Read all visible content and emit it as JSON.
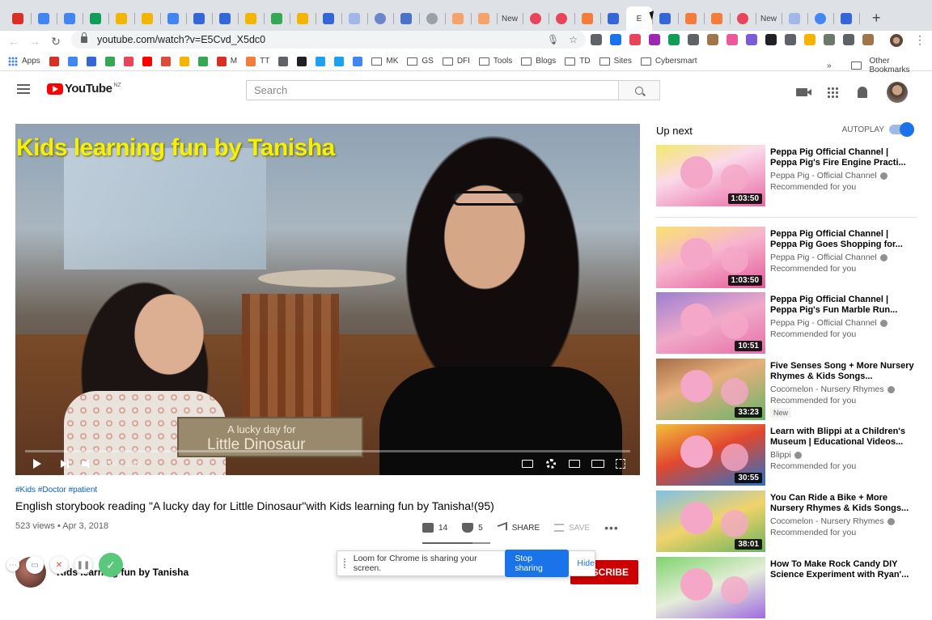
{
  "browser": {
    "tabs": [
      {
        "icon": "gmail-icon",
        "color": "#d93025",
        "text": ""
      },
      {
        "icon": "calendar-icon",
        "color": "#4285f4",
        "text": ""
      },
      {
        "icon": "docs-icon",
        "color": "#4285f4",
        "text": ""
      },
      {
        "icon": "sheets-icon",
        "color": "#0f9d58",
        "text": ""
      },
      {
        "icon": "hand-icon",
        "color": "#f4b400",
        "text": ""
      },
      {
        "icon": "slides-icon",
        "color": "#f4b400",
        "text": ""
      },
      {
        "icon": "docs-icon",
        "color": "#4285f4",
        "text": ""
      },
      {
        "icon": "forms-icon",
        "color": "#3367d6",
        "text": ""
      },
      {
        "icon": "forms-icon",
        "color": "#3367d6",
        "text": ""
      },
      {
        "icon": "slides-icon",
        "color": "#f4b400",
        "text": ""
      },
      {
        "icon": "drive-icon",
        "color": "#34a853",
        "text": ""
      },
      {
        "icon": "slides-icon",
        "color": "#f4b400",
        "text": ""
      },
      {
        "icon": "forms-icon",
        "color": "#3367d6",
        "text": ""
      },
      {
        "icon": "docs-icon",
        "color": "#a0b8e8",
        "text": ""
      },
      {
        "icon": "globe-icon",
        "color": "#6a87c8",
        "text": ""
      },
      {
        "icon": "site-icon",
        "color": "#4a72c8",
        "text": ""
      },
      {
        "icon": "globe-icon",
        "color": "#9aa0a6",
        "text": ""
      },
      {
        "icon": "blogger-icon",
        "color": "#f5a36b",
        "text": ""
      },
      {
        "icon": "blogger-icon",
        "color": "#f5a36b",
        "text": ""
      },
      {
        "icon": "new-tab",
        "color": "",
        "text": "New"
      },
      {
        "icon": "t-icon",
        "color": "#e8455b",
        "text": ""
      },
      {
        "icon": "t-icon",
        "color": "#e8455b",
        "text": ""
      },
      {
        "icon": "blogger-icon",
        "color": "#f57d3b",
        "text": ""
      },
      {
        "icon": "forms-icon",
        "color": "#3367d6",
        "text": ""
      },
      {
        "icon": "active-tab",
        "color": "",
        "text": "E"
      },
      {
        "icon": "forms-icon",
        "color": "#3367d6",
        "text": ""
      },
      {
        "icon": "blogger-icon",
        "color": "#f57d3b",
        "text": ""
      },
      {
        "icon": "blogger-icon",
        "color": "#f57d3b",
        "text": ""
      },
      {
        "icon": "spiral-icon",
        "color": "#e8455b",
        "text": ""
      },
      {
        "icon": "new-tab",
        "color": "",
        "text": "New"
      },
      {
        "icon": "docs-icon",
        "color": "#a0b8e8",
        "text": ""
      },
      {
        "icon": "google-icon",
        "color": "#4285f4",
        "text": ""
      },
      {
        "icon": "forms-icon",
        "color": "#3367d6",
        "text": ""
      }
    ],
    "new_tab_symbol": "+",
    "url": "youtube.com/watch?v=E5Cvd_X5dc0",
    "extension_colors": [
      "#5f6368",
      "#1a73e8",
      "#e8455b",
      "#9c27b0",
      "#0f9d58",
      "#5f6368",
      "#a0754a",
      "#e85a9a",
      "#7b5cd6",
      "#202124",
      "#5f6368",
      "#f4b400",
      "#6d7a6a",
      "#5f6368",
      "#a0754a"
    ],
    "bookmarks": [
      {
        "label": "Apps",
        "icon": "apps-grid-icon",
        "color": "#4285f4"
      },
      {
        "label": "",
        "icon": "gmail-icon",
        "color": "#d93025"
      },
      {
        "label": "",
        "icon": "calendar-icon",
        "color": "#4285f4"
      },
      {
        "label": "",
        "icon": "chat-icon",
        "color": "#3367d6"
      },
      {
        "label": "",
        "icon": "drive-icon",
        "color": "#34a853"
      },
      {
        "label": "",
        "icon": "t-icon",
        "color": "#e8455b"
      },
      {
        "label": "",
        "icon": "youtube-icon",
        "color": "#ff0000"
      },
      {
        "label": "",
        "icon": "google-plus-icon",
        "color": "#dd4b39"
      },
      {
        "label": "",
        "icon": "photos-icon",
        "color": "#f4b400"
      },
      {
        "label": "",
        "icon": "maps-icon",
        "color": "#34a853"
      },
      {
        "label": "M",
        "icon": "m-icon",
        "color": "#d93025"
      },
      {
        "label": "TT",
        "icon": "blogger-icon",
        "color": "#f57d3b"
      },
      {
        "label": "",
        "icon": "globe-icon",
        "color": "#5f6368"
      },
      {
        "label": "",
        "icon": "book-icon",
        "color": "#202124"
      },
      {
        "label": "",
        "icon": "twitter-icon",
        "color": "#1da1f2"
      },
      {
        "label": "",
        "icon": "twitter-icon",
        "color": "#1da1f2"
      },
      {
        "label": "",
        "icon": "google-icon",
        "color": "#4285f4"
      },
      {
        "label": "MK",
        "icon": "folder-icon",
        "color": ""
      },
      {
        "label": "GS",
        "icon": "folder-icon",
        "color": ""
      },
      {
        "label": "DFI",
        "icon": "folder-icon",
        "color": ""
      },
      {
        "label": "Tools",
        "icon": "folder-icon",
        "color": ""
      },
      {
        "label": "Blogs",
        "icon": "folder-icon",
        "color": ""
      },
      {
        "label": "TD",
        "icon": "folder-icon",
        "color": ""
      },
      {
        "label": "Sites",
        "icon": "folder-icon",
        "color": ""
      },
      {
        "label": "Cybersmart",
        "icon": "folder-icon",
        "color": ""
      }
    ],
    "bookmarks_overflow": "»",
    "other_bookmarks": "Other Bookmarks"
  },
  "youtube": {
    "logo_text": "YouTube",
    "logo_country": "NZ",
    "search_placeholder": "Search",
    "video": {
      "overlay_title": "Kids learning fun by Tanisha",
      "subtitle_line1": "A lucky day for",
      "subtitle_line2": "Little Dinosaur",
      "time": "0:00 / 3:49",
      "progress": 0,
      "hashtags": "#Kids #Doctor #patient",
      "title": "English storybook reading \"A lucky day for Little Dinosaur\"with Kids learning fun by Tanisha!(95)",
      "views_date": "523 views • Apr 3, 2018",
      "likes": "14",
      "dislikes": "5",
      "share_label": "SHARE",
      "save_label": "SAVE",
      "like_ratio": 0.74
    },
    "channel": {
      "name": "Kids learning fun by Tanisha",
      "subscribe_label": "SUBSCRIBE"
    },
    "up_next_label": "Up next",
    "autoplay_label": "AUTOPLAY",
    "recommendations": [
      {
        "title": "Peppa Pig Official Channel | Peppa Pig's Fire Engine Practi...",
        "channel": "Peppa Pig - Official Channel",
        "verified": true,
        "reason": "Recommended for you",
        "duration": "1:03:50",
        "new": "",
        "thumb": "peppa"
      },
      {
        "title": "Peppa Pig Official Channel | Peppa Pig Goes Shopping for...",
        "channel": "Peppa Pig - Official Channel",
        "verified": true,
        "reason": "Recommended for you",
        "duration": "1:03:50",
        "new": "",
        "thumb": "peppa2"
      },
      {
        "title": "Peppa Pig Official Channel | Peppa Pig's Fun Marble Run...",
        "channel": "Peppa Pig - Official Channel",
        "verified": true,
        "reason": "Recommended for you",
        "duration": "10:51",
        "new": "",
        "thumb": "peppa3"
      },
      {
        "title": "Five Senses Song + More Nursery Rhymes & Kids Songs...",
        "channel": "Cocomelon - Nursery Rhymes",
        "verified": true,
        "reason": "Recommended for you",
        "duration": "33:23",
        "new": "New",
        "thumb": "cocomelon"
      },
      {
        "title": "Learn with Blippi at a Children's Museum | Educational Videos...",
        "channel": "Blippi",
        "verified": true,
        "reason": "Recommended for you",
        "duration": "30:55",
        "new": "",
        "thumb": "blippi"
      },
      {
        "title": "You Can Ride a Bike + More Nursery Rhymes & Kids Songs...",
        "channel": "Cocomelon - Nursery Rhymes",
        "verified": true,
        "reason": "Recommended for you",
        "duration": "38:01",
        "new": "",
        "thumb": "bike"
      },
      {
        "title": "How To Make Rock Candy DIY Science Experiment with Ryan'...",
        "channel": "",
        "verified": false,
        "reason": "",
        "duration": "",
        "new": "",
        "thumb": "candy"
      }
    ]
  },
  "loom": {
    "message": "Loom for Chrome is sharing your screen.",
    "stop_label": "Stop sharing",
    "hide_label": "Hide"
  }
}
